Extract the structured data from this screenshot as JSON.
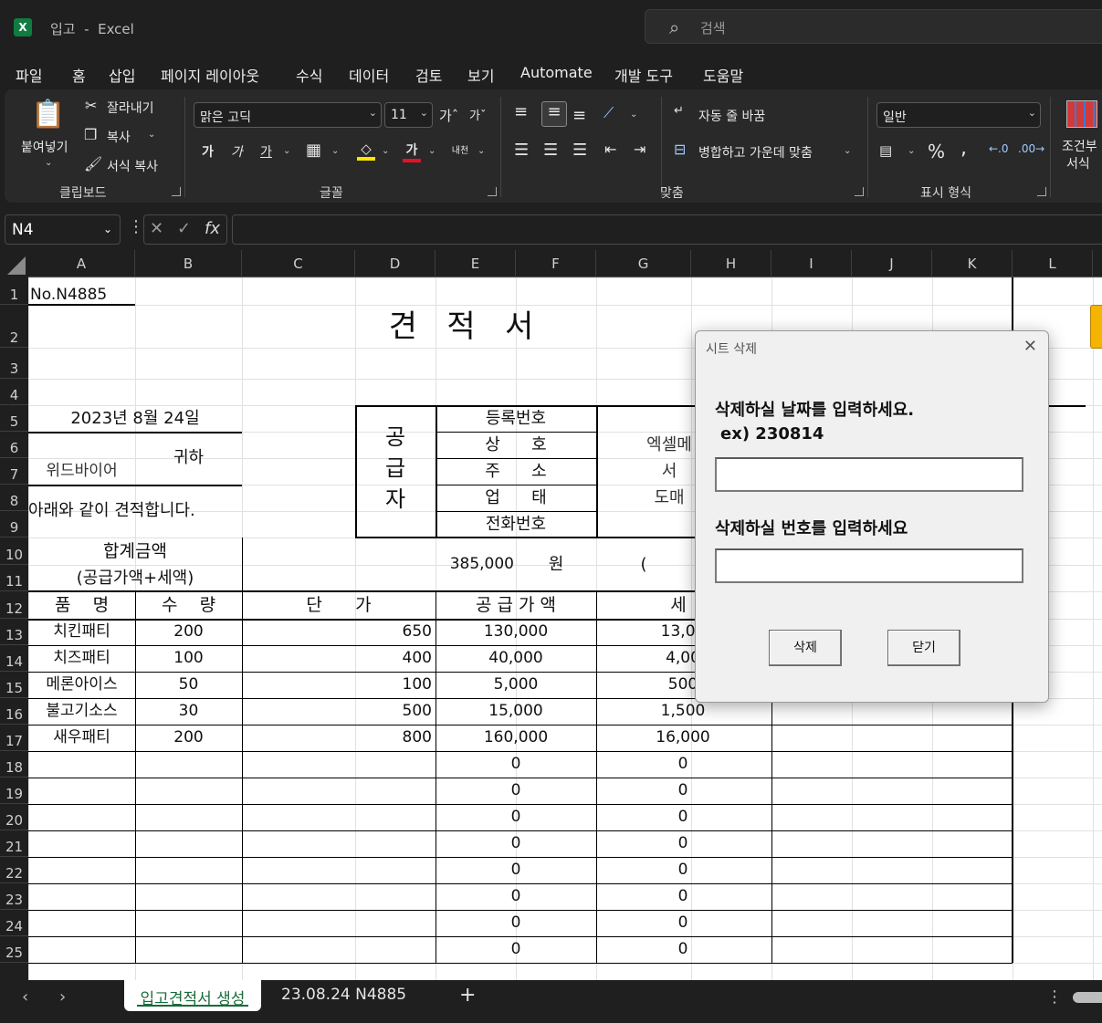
{
  "window": {
    "app_title": "입고  -  Excel",
    "search_placeholder": "검색"
  },
  "menu_tabs": [
    "파일",
    "홈",
    "삽입",
    "페이지 레이아웃",
    "수식",
    "데이터",
    "검토",
    "보기",
    "Automate",
    "개발 도구",
    "도움말"
  ],
  "active_menu_tab": "홈",
  "ribbon": {
    "clipboard": {
      "paste": "붙여넣기",
      "cut": "잘라내기",
      "copy": "복사",
      "format_painter": "서식 복사",
      "group_label": "클립보드"
    },
    "font": {
      "font_name": "맑은 고딕",
      "font_size": "11",
      "bold": "가",
      "italic": "가",
      "underline": "가",
      "font_color_glyph": "가",
      "phonetic": "내천",
      "group_label": "글꼴"
    },
    "alignment": {
      "wrap_text": "자동 줄 바꿈",
      "merge_center": "병합하고 가운데 맞춤",
      "group_label": "맞춤"
    },
    "number": {
      "format": "일반",
      "percent": "%",
      "comma": ",",
      "group_label": "표시 형식"
    },
    "styles": {
      "conditional_line1": "조건부",
      "conditional_line2": "서식"
    }
  },
  "formula_bar": {
    "name_box": "N4",
    "formula": ""
  },
  "columns": [
    "A",
    "B",
    "C",
    "D",
    "E",
    "F",
    "G",
    "H",
    "I",
    "J",
    "K",
    "L"
  ],
  "rows": [
    "1",
    "2",
    "3",
    "4",
    "5",
    "6",
    "7",
    "8",
    "9",
    "10",
    "11",
    "12",
    "13",
    "14",
    "15",
    "16",
    "17",
    "18",
    "19",
    "20",
    "21",
    "22",
    "23",
    "24",
    "25"
  ],
  "sheet": {
    "doc_no": "No.N4885",
    "title": "견   적   서",
    "date": "2023년 8월 24일",
    "customer": "위드바이어",
    "honorific": "귀하",
    "intro": "아래와 같이 견적합니다.",
    "supplier_label": [
      "공",
      "급",
      "자"
    ],
    "supplier_fields": [
      {
        "label": "등록번호",
        "value": ""
      },
      {
        "label": "상      호",
        "value": "엑셀메"
      },
      {
        "label": "주      소",
        "value": "서"
      },
      {
        "label": "업      태",
        "value": "도매"
      },
      {
        "label": "전화번호",
        "value": ""
      }
    ],
    "total_label_1": "합계금액",
    "total_label_2": "(공급가액+세액)",
    "total_amount": "385,000",
    "total_unit": "원",
    "total_paren": "(",
    "table_headers": {
      "item": "품    명",
      "qty": "수    량",
      "price": "단      가",
      "supply": "공 급 가 액",
      "tax": "세"
    },
    "items": [
      {
        "name": "치킨패티",
        "qty": "200",
        "price": "650",
        "supply": "130,000",
        "tax": "13,00"
      },
      {
        "name": "치즈패티",
        "qty": "100",
        "price": "400",
        "supply": "40,000",
        "tax": "4,00"
      },
      {
        "name": "메론아이스",
        "qty": "50",
        "price": "100",
        "supply": "5,000",
        "tax": "500"
      },
      {
        "name": "불고기소스",
        "qty": "30",
        "price": "500",
        "supply": "15,000",
        "tax": "1,500"
      },
      {
        "name": "새우패티",
        "qty": "200",
        "price": "800",
        "supply": "160,000",
        "tax": "16,000"
      }
    ],
    "empty_row_zero": "0"
  },
  "sheet_tabs": [
    "입고견적서 생성",
    "23.08.24 N4885"
  ],
  "active_sheet_tab": "입고견적서 생성",
  "dialog": {
    "title": "시트 삭제",
    "date_prompt": "삭제하실 날짜를 입력하세요.",
    "date_example": "ex) 230814",
    "date_value": "",
    "number_prompt": "삭제하실 번호를 입력하세요",
    "number_value": "",
    "delete_button": "삭제",
    "close_button": "닫기"
  }
}
